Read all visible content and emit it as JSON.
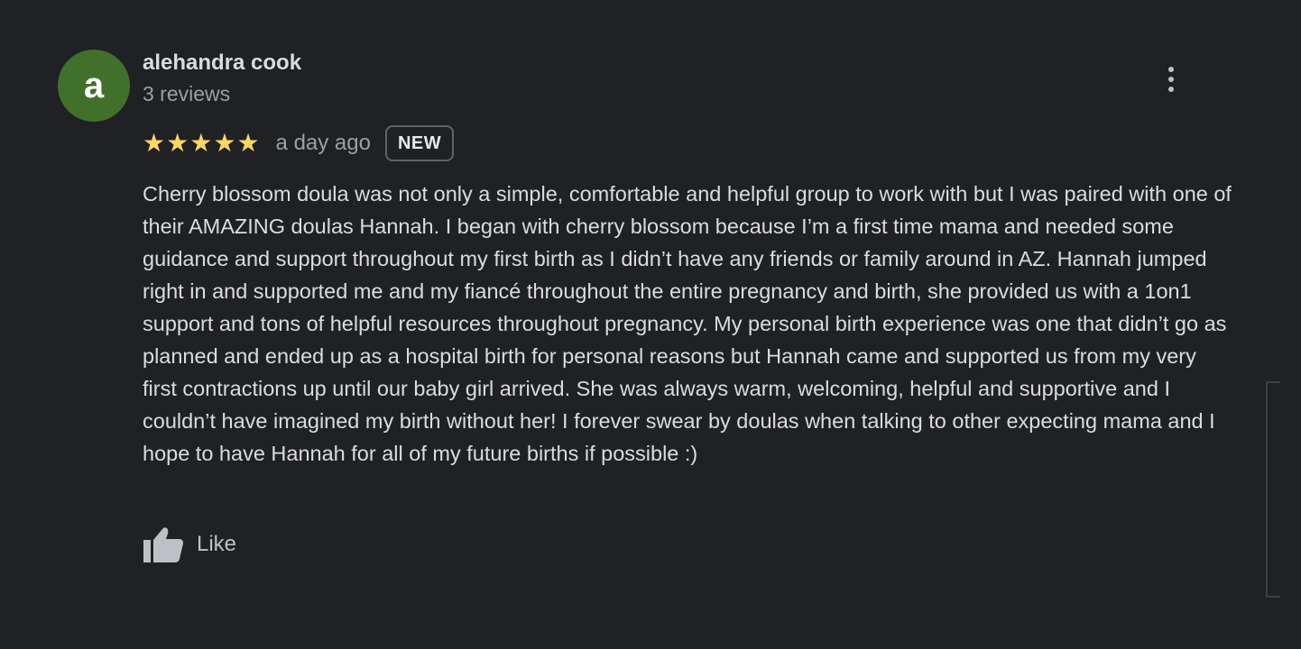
{
  "review": {
    "avatar_letter": "a",
    "author_name": "alehandra cook",
    "review_count": "3 reviews",
    "rating": 5,
    "max_rating": 5,
    "star_color": "#fdd663",
    "time_ago": "a day ago",
    "badge": "NEW",
    "text": "Cherry blossom doula was not only a simple, comfortable and helpful group to work with but I was paired with one of their AMAZING doulas Hannah. I began with cherry blossom because I’m a first time mama and needed some guidance and support throughout my first birth as I didn’t have any friends or family around in AZ. Hannah jumped right in and supported me and my fiancé throughout the entire pregnancy and birth, she provided us with a 1on1 support and tons of helpful resources throughout pregnancy. My personal birth experience was one that didn’t go as planned and ended up as a hospital birth for personal reasons but Hannah came and supported us from my very first contractions up until our baby girl arrived. She was always warm, welcoming, helpful and supportive and I couldn’t have imagined my birth without her! I forever swear by doulas when talking to other expecting mama and I hope to have Hannah for all of my future births if possible :)",
    "like_label": "Like",
    "avatar_color": "#41702a",
    "more_icon": "more-vert-icon",
    "like_icon": "thumbs-up-icon"
  }
}
